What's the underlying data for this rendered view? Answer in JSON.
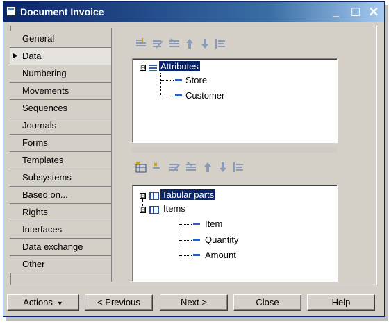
{
  "window": {
    "title": "Document Invoice",
    "controls": {
      "minimize": "_",
      "maximize": "□",
      "close": "×"
    }
  },
  "tabs": [
    {
      "label": "General",
      "selected": false
    },
    {
      "label": "Data",
      "selected": true
    },
    {
      "label": "Numbering",
      "selected": false
    },
    {
      "label": "Movements",
      "selected": false
    },
    {
      "label": "Sequences",
      "selected": false
    },
    {
      "label": "Journals",
      "selected": false
    },
    {
      "label": "Forms",
      "selected": false
    },
    {
      "label": "Templates",
      "selected": false
    },
    {
      "label": "Subsystems",
      "selected": false
    },
    {
      "label": "Based on...",
      "selected": false
    },
    {
      "label": "Rights",
      "selected": false
    },
    {
      "label": "Interfaces",
      "selected": false
    },
    {
      "label": "Data exchange",
      "selected": false
    },
    {
      "label": "Other",
      "selected": false
    }
  ],
  "attributes_tree": {
    "root": {
      "label": "Attributes",
      "expander": "⊟"
    },
    "children": [
      "Store",
      "Customer"
    ]
  },
  "tabular_tree": {
    "root": {
      "label": "Tabular parts",
      "expander": "⊟"
    },
    "items": {
      "label": "Items",
      "expander": "⊟",
      "children": [
        "Item",
        "Quantity",
        "Amount"
      ]
    }
  },
  "buttons": {
    "actions": "Actions",
    "actions_arrow": "▼",
    "previous": "< Previous",
    "next": "Next >",
    "close": "Close",
    "help": "Help"
  },
  "colors": {
    "title_gradient_start": "#0a246a",
    "selection": "#0a246a",
    "face": "#d4d0c8"
  }
}
